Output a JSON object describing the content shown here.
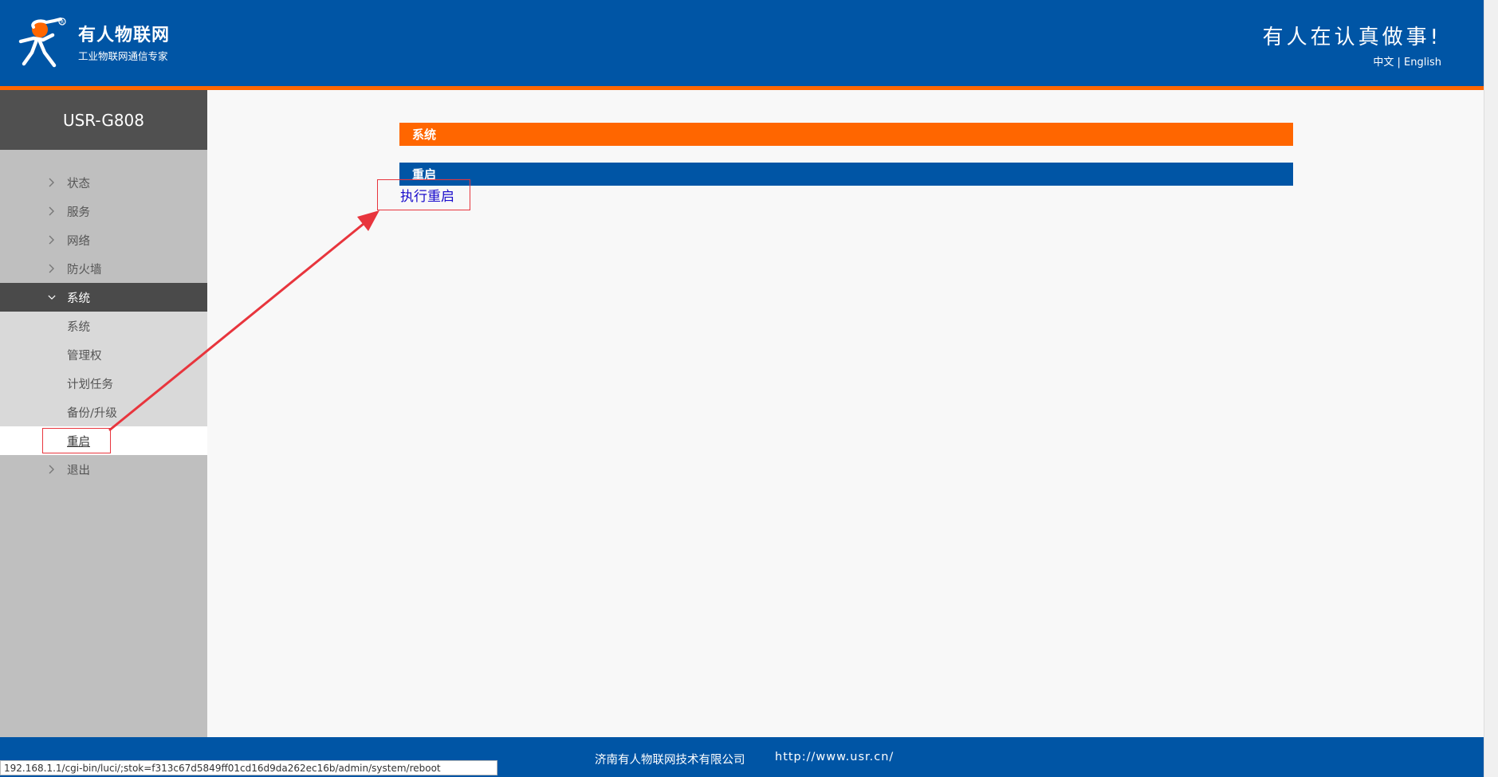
{
  "header": {
    "brand_name": "有人物联网",
    "brand_sub": "工业物联网通信专家",
    "slogan": "有人在认真做事!",
    "lang_cn": "中文",
    "lang_sep": "|",
    "lang_en": "English"
  },
  "sidebar": {
    "device": "USR-G808",
    "items": [
      {
        "label": "状态"
      },
      {
        "label": "服务"
      },
      {
        "label": "网络"
      },
      {
        "label": "防火墙"
      },
      {
        "label": "系统"
      },
      {
        "label": "退出"
      }
    ],
    "sub_items": [
      {
        "label": "系统"
      },
      {
        "label": "管理权"
      },
      {
        "label": "计划任务"
      },
      {
        "label": "备份/升级"
      },
      {
        "label": "重启"
      }
    ]
  },
  "main": {
    "section_title": "系统",
    "subsection_title": "重启",
    "action_link": "执行重启"
  },
  "footer": {
    "company": "济南有人物联网技术有限公司",
    "url": "http://www.usr.cn/"
  },
  "statusbar": {
    "url": "192.168.1.1/cgi-bin/luci/;stok=f313c67d5849ff01cd16d9da262ec16b/admin/system/reboot"
  },
  "colors": {
    "brand_blue": "#0055a5",
    "accent_orange": "#ff6600",
    "annotation_red": "#e8353d"
  }
}
